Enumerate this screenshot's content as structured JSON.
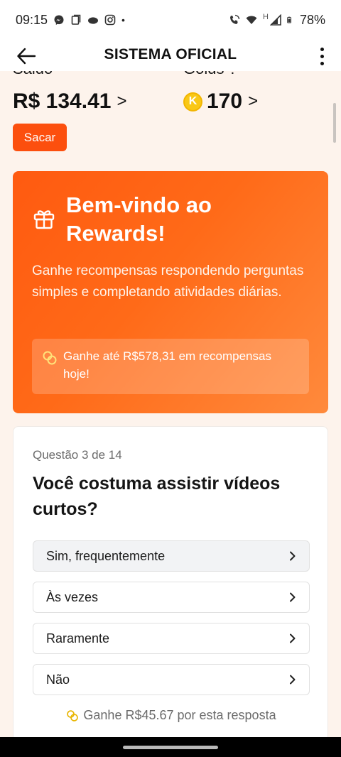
{
  "status_bar": {
    "time": "09:15",
    "dot": "•",
    "battery": "78%",
    "network_letter": "H",
    "icons_left": [
      "messenger-icon",
      "screenshot-icon",
      "cloud-icon",
      "instagram-icon"
    ],
    "icons_right": [
      "wifi-call-icon",
      "wifi-icon",
      "signal-icon",
      "battery-icon"
    ]
  },
  "app_bar": {
    "title": "SISTEMA OFICIAL",
    "back_icon": "arrow-left-icon",
    "menu_icon": "more-vert-icon"
  },
  "balances": {
    "saldo_label": "Saldo",
    "saldo_value": "R$ 134.41",
    "saldo_arrow": ">",
    "golds_label": "Golds ?",
    "golds_value": "170",
    "golds_arrow": ">",
    "coin_letter": "K",
    "withdraw_label": "Sacar"
  },
  "welcome": {
    "title": "Bem-vindo ao Rewards!",
    "description": "Ganhe recompensas respondendo perguntas simples e completando atividades diárias.",
    "promo_text": "Ganhe até R$578,31 em recompensas hoje!"
  },
  "question": {
    "counter": "Questão 3 de 14",
    "title": "Você costuma assistir vídeos curtos?",
    "options": [
      {
        "label": "Sim, frequentemente"
      },
      {
        "label": "Às vezes"
      },
      {
        "label": "Raramente"
      },
      {
        "label": "Não"
      }
    ],
    "reward_text": "Ganhe R$45.67 por esta resposta"
  },
  "colors": {
    "accent": "#fc4f0e",
    "page_background": "#fdf3ec",
    "gold": "#f9c817"
  }
}
